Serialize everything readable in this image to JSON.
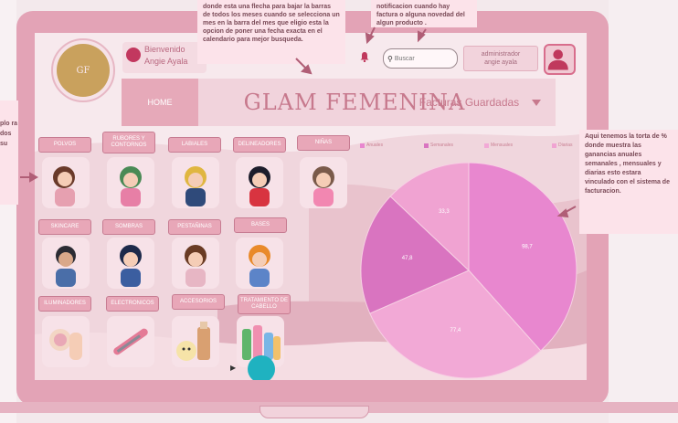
{
  "header": {
    "welcome_line1": "Bienvenido",
    "welcome_line2": "Angie Ayala",
    "search_placeholder": "Buscar",
    "admin_line1": "administrador",
    "admin_line2": "angie ayala",
    "logo_text": "GF"
  },
  "nav": {
    "home_label": "HOME",
    "title": "GLAM FEMENINA",
    "facturas_label": "Facturas Guardadas"
  },
  "categories": [
    {
      "label": "POLVOS"
    },
    {
      "label": "RUBORES Y CONTORNOS"
    },
    {
      "label": "LABIALES"
    },
    {
      "label": "DELINEADORES"
    },
    {
      "label": "NIÑAS"
    },
    {
      "label": "SKINCARE"
    },
    {
      "label": "SOMBRAS"
    },
    {
      "label": "PESTAÑINAS"
    },
    {
      "label": "BASES"
    },
    {
      "label": "ILUMINADORES"
    },
    {
      "label": "ELECTRONICOS"
    },
    {
      "label": "ACCESORIOS"
    },
    {
      "label": "TRATAMIENTO DE CABELLO"
    }
  ],
  "chart_data": {
    "type": "pie",
    "legend": [
      "Anuales",
      "Semanales",
      "Mensuales",
      "Diarias"
    ],
    "slices": [
      {
        "label": "98,7",
        "value": 98.7,
        "color": "#e887cf"
      },
      {
        "label": "77,4",
        "value": 77.4,
        "color": "#f2a9d6"
      },
      {
        "label": "47,8",
        "value": 47.8,
        "color": "#d974c0"
      },
      {
        "label": "33,3",
        "value": 33.3,
        "color": "#f0a3d2"
      }
    ]
  },
  "notes": {
    "top_left": "donde esta una flecha para bajar la barras de todos los meses cuando se selecciona un mes en la barra del mes que eligio esta la opcion de poner una fecha exacta en el calendario para mejor busqueda.",
    "top_right": "notificacion cuando hay factura o alguna novedad del algun producto .",
    "right": "Aqui tenemos la torta de % donde muestra las ganancias anuales semanales , mensuales y diarias esto estara vinculado con el sistema de facturacion.",
    "left_fragment": "plo ra dos su"
  },
  "colors": {
    "frame": "#e3a3b6",
    "accent": "#e8a7b8",
    "title": "#c7798d",
    "teal": "#1fb2c0"
  }
}
